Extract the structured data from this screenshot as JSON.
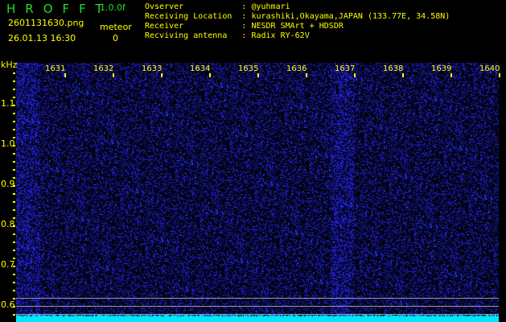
{
  "header": {
    "title": "HROFFT",
    "version": "1.0.0f",
    "filename": "2601131630.png",
    "datetime": "26.01.13 16:30",
    "mode_label": "meteor",
    "count": "0"
  },
  "info": [
    {
      "label": "Ovserver            ",
      "value": "@yuhmari"
    },
    {
      "label": "Receiving Location  ",
      "value": "kurashiki,Okayama,JAPAN (133.77E, 34.58N)"
    },
    {
      "label": "Receiver            ",
      "value": "NESDR SMArt + HDSDR"
    },
    {
      "label": "Recviving antenna   ",
      "value": "Radix RY-62V"
    }
  ],
  "axis": {
    "unit": "kHz",
    "freq_labels": [
      "1631",
      "1632",
      "1633",
      "1634",
      "1635",
      "1636",
      "1637",
      "1638",
      "1639",
      "1640"
    ],
    "y_labels": [
      "1.1",
      "1.0",
      "0.9",
      "0.8",
      "0.7",
      "0.6"
    ]
  },
  "colors": {
    "text": "#ffff00",
    "title": "#22dd22",
    "signal": "#2a2aff",
    "baseline": "#00ffff"
  }
}
